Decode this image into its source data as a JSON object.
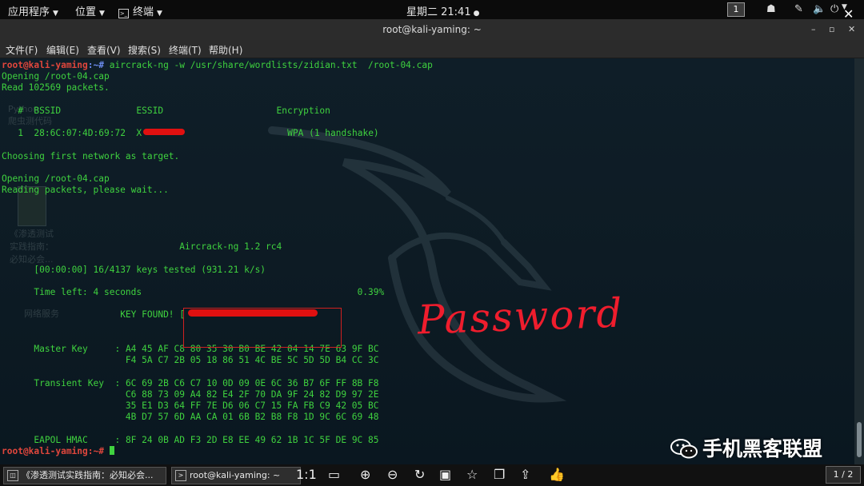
{
  "top_panel": {
    "apps_label": "应用程序",
    "places_label": "位置",
    "terminal_label": "终端",
    "clock": "星期二 21:41",
    "workspace": "1"
  },
  "window": {
    "title": "root@kali-yaming: ~",
    "buttons": [
      "–",
      "▫",
      "✕"
    ]
  },
  "menubar": [
    "文件(F)",
    "编辑(E)",
    "查看(V)",
    "搜索(S)",
    "终端(T)",
    "帮助(H)"
  ],
  "terminal": {
    "prompt_user": "root@kali-yaming",
    "prompt_path": ":~#",
    "command": " aircrack-ng -w /usr/share/wordlists/zidian.txt  /root-04.cap",
    "line_opening1": "Opening /root-04.cap",
    "line_read": "Read 102569 packets.",
    "table_header": "   #  BSSID              ESSID                     Encryption",
    "row_index": "   1  ",
    "row_bssid": "28:6C:07:4D:69:72",
    "row_gap": "  ",
    "row_essid_start": "X",
    "row_encryption": "WPA (1 handshake)",
    "line_choosing": "Choosing first network as target.",
    "line_opening2": "Opening /root-04.cap",
    "line_reading": "Reading packets, please wait...",
    "version": "Aircrack-ng 1.2 rc4",
    "keys_tested": "[00:00:00] 16/4137 keys tested (931.21 k/s)",
    "time_left": "Time left: 4 seconds",
    "percent": "0.39%",
    "key_found": "KEY FOUND! [",
    "master_key_label": "Master Key",
    "master_key_lines": [
      "A4 45 AF C8 80 35 30 B0 BE 42 04 14 7E 63 9F BC",
      "F4 5A C7 2B 05 18 86 51 4C BE 5C 5D 5D B4 CC 3C"
    ],
    "transient_key_label": "Transient Key",
    "transient_key_lines": [
      "6C 69 2B C6 C7 10 0D 09 0E 6C 36 B7 6F FF 8B F8",
      "C6 88 73 09 A4 82 E4 2F 70 DA 9F 24 82 D9 97 2E",
      "35 E1 D3 64 FF 7E D6 06 C7 15 FA FB C9 42 05 BC",
      "4B D7 57 6D AA CA 01 6B B2 B8 F8 1D 9C 6C 69 48"
    ],
    "eapol_label": "EAPOL HMAC",
    "eapol_line": "8F 24 0B AD F3 2D E8 EE 49 62 1B 1C 5F DE 9C 85",
    "last_prompt": "root@kali-yaming:~#"
  },
  "annotation": {
    "password_label": "Password",
    "accent_color": "#ef1d2d"
  },
  "desktop_ghost": {
    "icon1_label": "Python\n爬虫测代码",
    "icon2_label": "《渗透测试\n实践指南：\n必知必会...",
    "icon3_label": "网络服务"
  },
  "taskbar": {
    "task1": "《渗透测试实践指南：必知必会...",
    "task2": "root@kali-yaming: ~",
    "zoom_label": "1:1",
    "page": "1 / 2"
  },
  "watermark": {
    "text": "手机黑客联盟"
  }
}
